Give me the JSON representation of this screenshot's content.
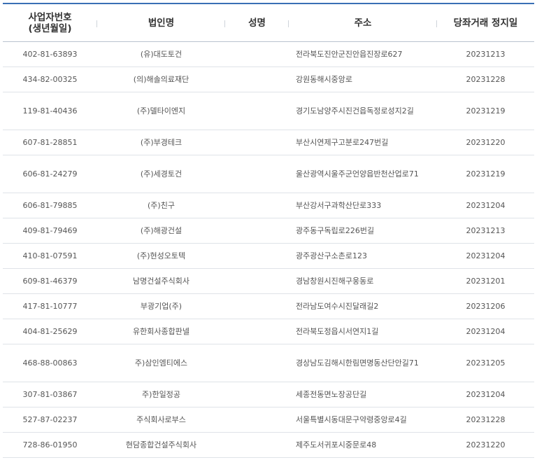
{
  "table": {
    "headers": {
      "biz_no_line1": "사업자번호",
      "biz_no_line2": "(생년월일)",
      "corp_name": "법인명",
      "person_name": "성명",
      "address": "주소",
      "stop_date": "당좌거래 정지일"
    },
    "rows": [
      {
        "biz_no": "402-81-63893",
        "corp": "(유)대도토건",
        "name": "",
        "addr": "전라북도진안군진안읍진장로627",
        "date": "20231213",
        "lines": 1
      },
      {
        "biz_no": "434-82-00325",
        "corp": "(의)해솔의료재단",
        "name": "",
        "addr": "강원동해시중앙로",
        "date": "20231228",
        "lines": 1
      },
      {
        "biz_no": "119-81-40436",
        "corp": "(주)델타이엔지",
        "name": "",
        "addr": "경기도남양주시진건읍독정로성지2길",
        "date": "20231219",
        "lines": 2
      },
      {
        "biz_no": "607-81-28851",
        "corp": "(주)부경테크",
        "name": "",
        "addr": "부산시연제구고분로247번길",
        "date": "20231220",
        "lines": 1
      },
      {
        "biz_no": "606-81-24279",
        "corp": "(주)세경토건",
        "name": "",
        "addr": "울산광역시울주군언양읍반천산업로71",
        "date": "20231219",
        "lines": 2
      },
      {
        "biz_no": "606-81-79885",
        "corp": "(주)친구",
        "name": "",
        "addr": "부산강서구과학산단로333",
        "date": "20231204",
        "lines": 1
      },
      {
        "biz_no": "409-81-79469",
        "corp": "(주)해광건설",
        "name": "",
        "addr": "광주동구독립로226번길",
        "date": "20231213",
        "lines": 1
      },
      {
        "biz_no": "410-81-07591",
        "corp": "(주)현성오토텍",
        "name": "",
        "addr": "광주광산구소촌로123",
        "date": "20231204",
        "lines": 1
      },
      {
        "biz_no": "609-81-46379",
        "corp": "남명건설주식회사",
        "name": "",
        "addr": "경남창원시진해구웅동로",
        "date": "20231201",
        "lines": 1
      },
      {
        "biz_no": "417-81-10777",
        "corp": "부광기업(주)",
        "name": "",
        "addr": "전라남도여수시진달래길2",
        "date": "20231206",
        "lines": 1
      },
      {
        "biz_no": "404-81-25629",
        "corp": "유한회사종합판넬",
        "name": "",
        "addr": "전라북도정읍시서연지1길",
        "date": "20231204",
        "lines": 1
      },
      {
        "biz_no": "468-88-00863",
        "corp": "주)삼인엠티에스",
        "name": "",
        "addr": "경상남도김해시한림면명동산단안길71",
        "date": "20231205",
        "lines": 2
      },
      {
        "biz_no": "307-81-03867",
        "corp": "주)한일정공",
        "name": "",
        "addr": "세종전동면노장공단길",
        "date": "20231204",
        "lines": 1
      },
      {
        "biz_no": "527-87-02237",
        "corp": "주식회사로부스",
        "name": "",
        "addr": "서울특별시동대문구약령중앙로4길",
        "date": "20231228",
        "lines": 1
      },
      {
        "biz_no": "728-86-01950",
        "corp": "현담종합건설주식회사",
        "name": "",
        "addr": "제주도서귀포시중문로48",
        "date": "20231220",
        "lines": 1
      }
    ]
  }
}
